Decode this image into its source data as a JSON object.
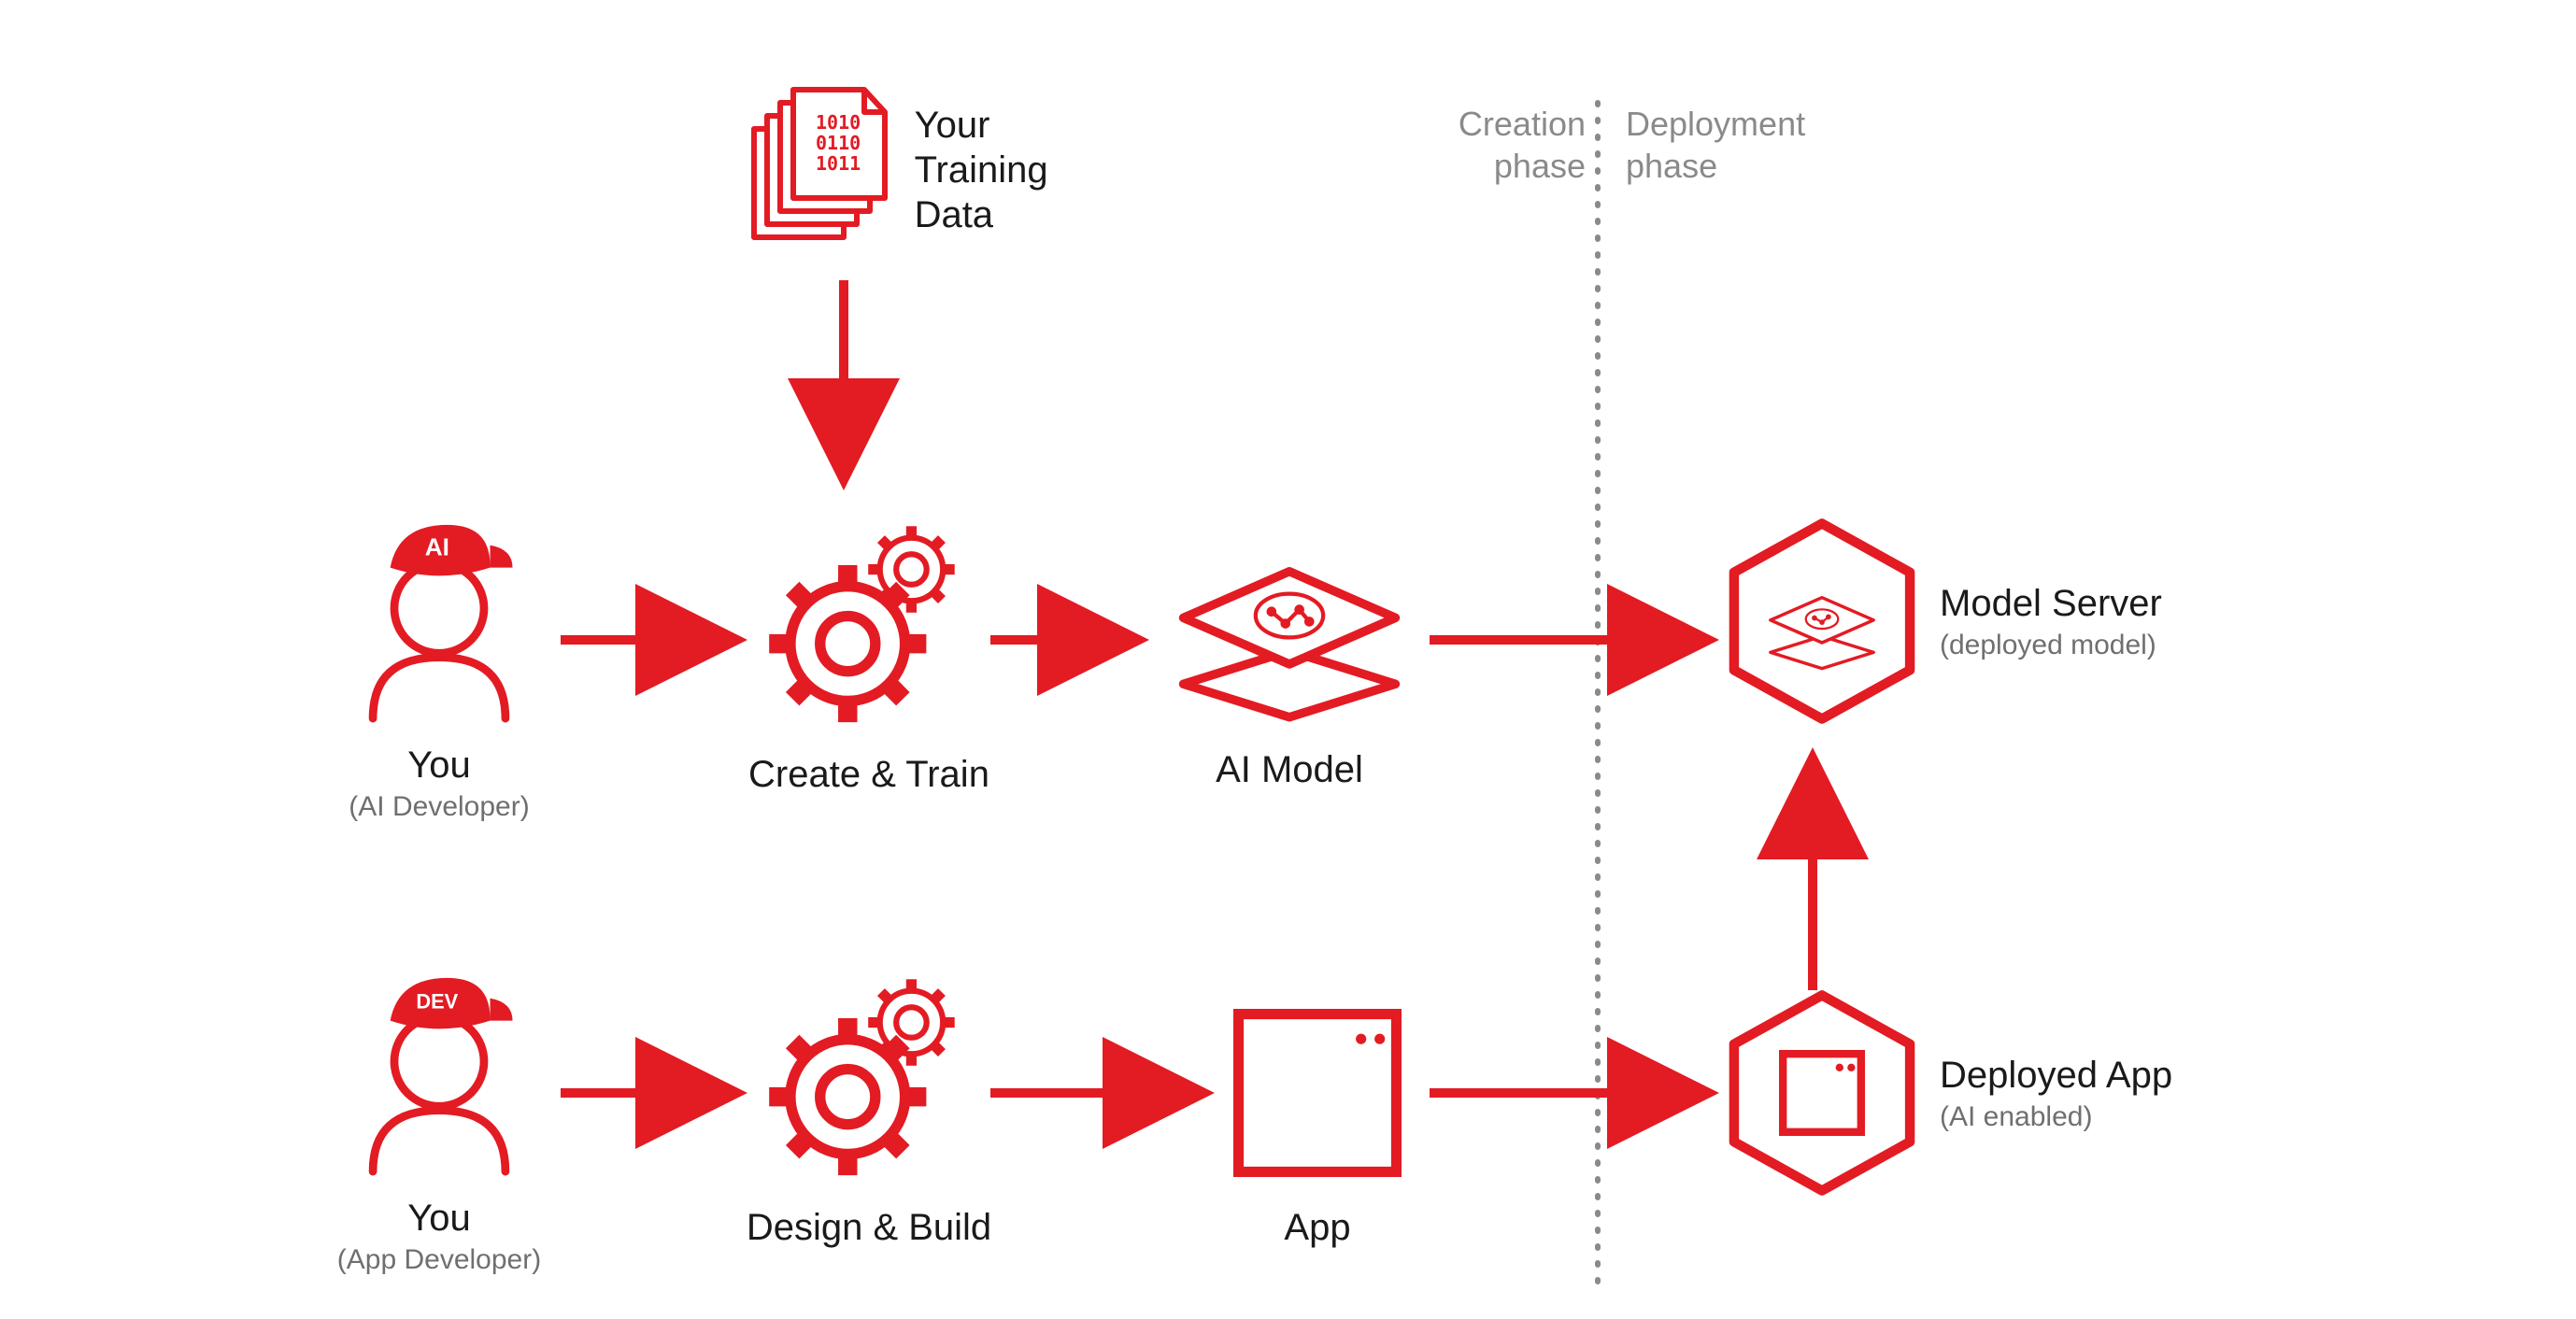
{
  "colors": {
    "accent": "#E31B23",
    "muted": "#8a8a8a"
  },
  "phases": {
    "creation": {
      "line1": "Creation",
      "line2": "phase"
    },
    "deployment": {
      "line1": "Deployment",
      "line2": "phase"
    }
  },
  "nodes": {
    "training_data": {
      "line1": "Your",
      "line2": "Training Data"
    },
    "ai_dev": {
      "label": "You",
      "sublabel": "(AI Developer)",
      "cap_text": "AI"
    },
    "create_train": {
      "label": "Create & Train"
    },
    "ai_model": {
      "label": "AI Model"
    },
    "model_server": {
      "label": "Model Server",
      "sublabel": "(deployed model)"
    },
    "app_dev": {
      "label": "You",
      "sublabel": "(App Developer)",
      "cap_text": "DEV"
    },
    "design_build": {
      "label": "Design & Build"
    },
    "app": {
      "label": "App"
    },
    "deployed_app": {
      "label": "Deployed App",
      "sublabel": "(AI enabled)"
    }
  }
}
